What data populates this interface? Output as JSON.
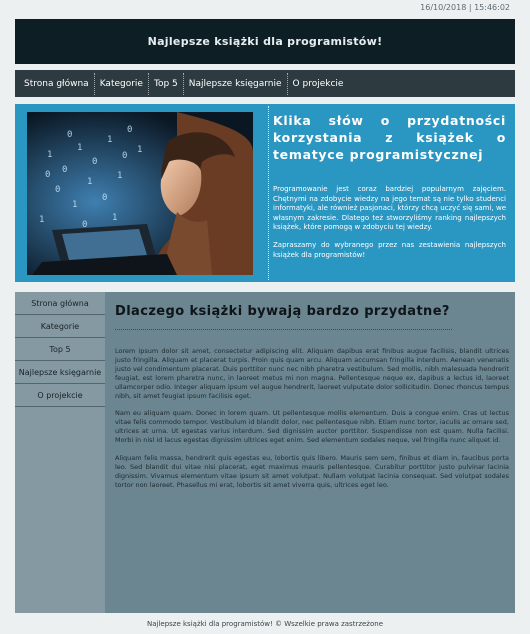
{
  "timestamp": "16/10/2018 | 15:46:02",
  "header": {
    "title": "Najlepsze książki dla programistów!"
  },
  "topnav": {
    "items": [
      "Strona główna",
      "Kategorie",
      "Top 5",
      "Najlepsze księgarnie",
      "O projekcie"
    ]
  },
  "hero": {
    "title": "Klika słów o przydatności korzystania z książek o tematyce programistycznej",
    "paragraph1": "Programowanie jest coraz bardziej popularnym zajęciem. Chętnymi na zdobycie wiedzy na jego temat są nie tylko studenci informatyki, ale również pasjonaci, którzy chcą uczyć się sami, we własnym zakresie. Dlatego też stworzyliśmy ranking najlepszych książek, które pomogą w zdobyciu tej wiedzy.",
    "paragraph2": "Zapraszamy do wybranego przez nas zestawienia najlepszych książek dla programistów!"
  },
  "sidebar": {
    "items": [
      "Strona główna",
      "Kategorie",
      "Top 5",
      "Najlepsze księgarnie",
      "O projekcie"
    ]
  },
  "article": {
    "heading": "Dlaczego książki bywają bardzo przydatne?",
    "paragraphs": [
      "Lorem ipsum dolor sit amet, consectetur adipiscing elit. Aliquam dapibus erat finibus augue facilisis, blandit ultrices justo fringilla. Aliquam et placerat turpis. Proin quis quam arcu. Aliquam accumsan fringilla interdum. Aenean venenatis justo vel condimentum placerat. Duis porttitor nunc nec nibh pharetra vestibulum. Sed mollis, nibh malesuada hendrerit feugiat, est lorem pharetra nunc, in laoreet metus mi non magna. Pellentesque neque ex, dapibus a lectus id, laoreet ullamcorper odio. Integer aliquam ipsum vel augue hendrerit, laoreet vulputate dolor sollicitudin. Donec rhoncus tempus nibh, sit amet feugiat ipsum facilisis eget.",
      "Nam eu aliquam quam. Donec in lorem quam. Ut pellentesque mollis elementum. Duis a congue enim. Cras ut lectus vitae felis commodo tempor. Vestibulum id blandit dolor, nec pellentesque nibh. Etiam nunc tortor, iaculis ac ornare sed, ultrices at urna. Ut egestas varius interdum. Sed dignissim auctor porttitor. Suspendisse non est quam. Nulla facilisi. Morbi in nisl id lacus egestas dignissim ultrices eget enim. Sed elementum sodales neque, vel fringilla nunc aliquet id.",
      "Aliquam felis massa, hendrerit quis egestas eu, lobortis quis libero. Mauris sem sem, finibus et diam in, faucibus porta leo. Sed blandit dui vitae nisi placerat, eget maximus mauris pellentesque. Curabitur porttitor justo pulvinar lacinia dignissim. Vivamus elementum vitae ipsum sit amet volutpat. Nullam volutpat lacinia consequat. Sed volutpat sodales tortor non laoreet. Phasellus mi erat, lobortis sit amet viverra quis, ultrices eget leo."
    ]
  },
  "footer": {
    "text": "Najlepsze książki dla programistów! © Wszelkie prawa zastrzeżone"
  },
  "colors": {
    "header_bg": "#0d1f24",
    "nav_bg": "#2d3b40",
    "hero_bg": "#2a96c2",
    "main_bg": "#6b8591",
    "sidebar_bg": "#8499a2",
    "page_bg": "#ecf0f1"
  }
}
